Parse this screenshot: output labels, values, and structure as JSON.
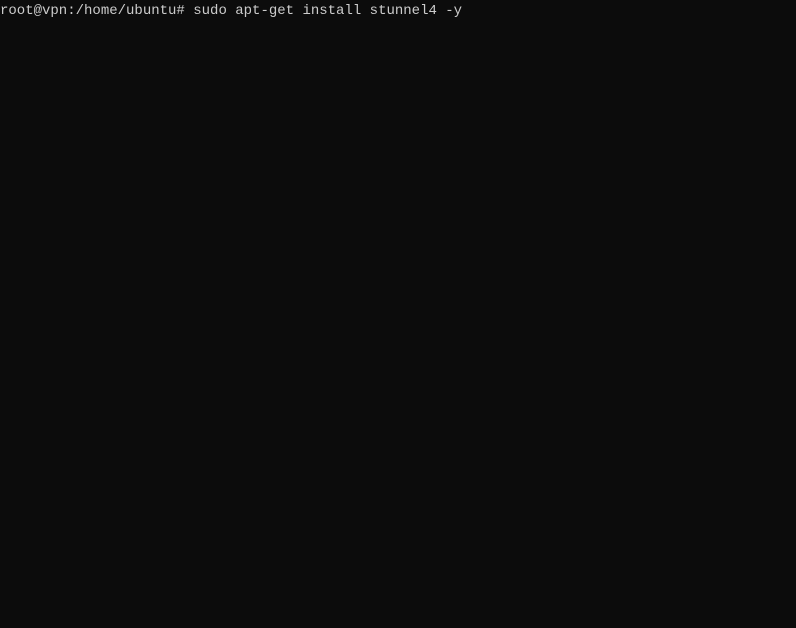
{
  "terminal": {
    "prompt": "root@vpn:/home/ubuntu# ",
    "command": "sudo apt-get install stunnel4 -y"
  }
}
